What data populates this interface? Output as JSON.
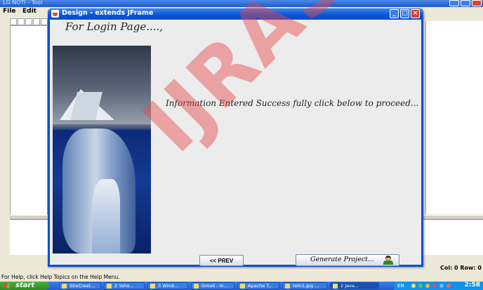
{
  "background_app": {
    "title": "LG NOTI - Tool",
    "menu": [
      "File",
      "Edit"
    ],
    "status_position": "Col: 0 Row: 0",
    "help_text": "For Help, click Help Topics on the Help Menu."
  },
  "jframe": {
    "title": "Design - extends JFrame",
    "heading": "For Login Page....,",
    "info_message": "Information Entered Success fully click below to proceed...",
    "prev_button": "<< PREV",
    "generate_button": "Generate Project..."
  },
  "watermark": "IJRASET",
  "taskbar": {
    "start": "start",
    "tasks": [
      {
        "label": "SiteCreat..."
      },
      {
        "label": "2 Yaho..."
      },
      {
        "label": "3 Wind..."
      },
      {
        "label": "Gmail - In..."
      },
      {
        "label": "Apache T..."
      },
      {
        "label": "tem1.jpg ..."
      },
      {
        "label": "2 Java..."
      }
    ],
    "language": "EN",
    "clock": "2:58"
  },
  "colors": {
    "titlebar_blue": "#0b52d8",
    "close_red": "#d8452b",
    "watermark_red": "#e84848",
    "start_green": "#2d8a22"
  }
}
